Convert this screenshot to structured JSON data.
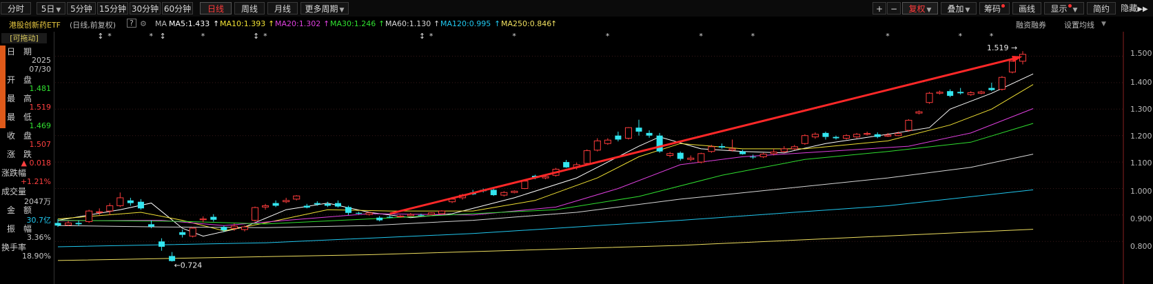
{
  "toolbar": {
    "left": [
      "分时",
      "5日",
      "5分钟",
      "15分钟",
      "30分钟",
      "60分钟",
      "日线",
      "周线",
      "月线",
      "更多周期"
    ],
    "active": "日线",
    "right": [
      "+",
      "−",
      "复权",
      "叠加",
      "筹码",
      "画线",
      "显示",
      "简约",
      "隐藏"
    ]
  },
  "info": {
    "name": "港股创新药ETF",
    "period": "(日线,前复权)",
    "help": "?",
    "ma_label": "MA",
    "ma": [
      {
        "text": "MA5:1.433",
        "color": "#ffffff"
      },
      {
        "text": "MA10:1.393",
        "color": "#f2e234"
      },
      {
        "text": "MA20:1.302",
        "color": "#e040e0"
      },
      {
        "text": "MA30:1.246",
        "color": "#30e030"
      },
      {
        "text": "MA60:1.130",
        "color": "#d8d8d8"
      },
      {
        "text": "MA120:0.995",
        "color": "#20c8f0"
      },
      {
        "text": "MA250:0.846",
        "color": "#f0e060"
      }
    ],
    "right1": "融资融券",
    "right2": "设置均线"
  },
  "panel": {
    "drag": "[可拖动]",
    "rows": [
      {
        "label": "日　期",
        "value": "2025",
        "value2": "07/30",
        "color": "#c8c8c8"
      },
      {
        "label": "开　盘",
        "value": "1.481",
        "color": "#30e030"
      },
      {
        "label": "最　高",
        "value": "1.519",
        "color": "#ff4040"
      },
      {
        "label": "最　低",
        "value": "1.469",
        "color": "#30e030"
      },
      {
        "label": "收　盘",
        "value": "1.507",
        "color": "#ff4040"
      },
      {
        "label": "涨　跌",
        "value": "▲ 0.018",
        "color": "#ff4040"
      },
      {
        "label": "涨跌幅",
        "value": "+1.21%",
        "color": "#ff4040"
      },
      {
        "label": "成交量",
        "value": "2047万",
        "color": "#c8c8c8"
      },
      {
        "label": "金　额",
        "value": "30.7亿",
        "color": "#20c8f0"
      },
      {
        "label": "振　幅",
        "value": "3.36%",
        "color": "#c8c8c8"
      },
      {
        "label": "换手率",
        "value": "18.90%",
        "color": "#c8c8c8"
      }
    ]
  },
  "chart_data": {
    "type": "candlestick",
    "y_ticks": [
      "1.500",
      "1.400",
      "1.300",
      "1.200",
      "1.100",
      "1.000",
      "0.900",
      "0.800"
    ],
    "ylim": [
      0.72,
      1.53
    ],
    "high_marker": "1.519",
    "low_marker": "0.724",
    "candles": [
      [
        0.87,
        0.86,
        0.885,
        0.855
      ],
      [
        0.862,
        0.87,
        0.878,
        0.858
      ],
      [
        0.87,
        0.865,
        0.88,
        0.858
      ],
      [
        0.875,
        0.915,
        0.92,
        0.87
      ],
      [
        0.91,
        0.912,
        0.925,
        0.9
      ],
      [
        0.915,
        0.935,
        0.945,
        0.9
      ],
      [
        0.935,
        0.965,
        0.985,
        0.93
      ],
      [
        0.955,
        0.945,
        0.965,
        0.935
      ],
      [
        0.95,
        0.925,
        0.96,
        0.92
      ],
      [
        0.865,
        0.856,
        0.88,
        0.85
      ],
      [
        0.8,
        0.78,
        0.812,
        0.765
      ],
      [
        0.745,
        0.726,
        0.76,
        0.724
      ],
      [
        0.835,
        0.825,
        0.845,
        0.815
      ],
      [
        0.82,
        0.85,
        0.855,
        0.815
      ],
      [
        0.882,
        0.885,
        0.895,
        0.872
      ],
      [
        0.893,
        0.882,
        0.903,
        0.875
      ],
      [
        0.855,
        0.842,
        0.86,
        0.835
      ],
      [
        0.85,
        0.858,
        0.868,
        0.84
      ],
      [
        0.845,
        0.855,
        0.86,
        0.838
      ],
      [
        0.88,
        0.928,
        0.932,
        0.875
      ],
      [
        0.93,
        0.935,
        0.942,
        0.92
      ],
      [
        0.945,
        0.935,
        0.955,
        0.93
      ],
      [
        0.95,
        0.955,
        0.965,
        0.945
      ],
      [
        0.96,
        0.972,
        0.975,
        0.955
      ],
      [
        0.935,
        0.928,
        0.942,
        0.925
      ],
      [
        0.945,
        0.94,
        0.952,
        0.935
      ],
      [
        0.942,
        0.935,
        0.95,
        0.93
      ],
      [
        0.945,
        0.932,
        0.955,
        0.928
      ],
      [
        0.93,
        0.908,
        0.935,
        0.9
      ],
      [
        0.908,
        0.905,
        0.912,
        0.902
      ],
      [
        0.902,
        0.908,
        0.912,
        0.898
      ],
      [
        0.89,
        0.88,
        0.896,
        0.876
      ],
      [
        0.893,
        0.89,
        0.898,
        0.888
      ],
      [
        0.893,
        0.896,
        0.9,
        0.89
      ],
      [
        0.897,
        0.902,
        0.908,
        0.895
      ],
      [
        0.9,
        0.898,
        0.905,
        0.896
      ],
      [
        0.902,
        0.908,
        0.91,
        0.9
      ],
      [
        0.905,
        0.915,
        0.918,
        0.903
      ],
      [
        0.95,
        0.96,
        0.968,
        0.945
      ],
      [
        0.965,
        0.975,
        0.98,
        0.958
      ],
      [
        0.985,
        0.978,
        0.995,
        0.975
      ],
      [
        0.995,
        0.99,
        1.0,
        0.985
      ],
      [
        0.995,
        0.975,
        1.0,
        0.972
      ],
      [
        0.975,
        0.985,
        0.99,
        0.97
      ],
      [
        0.985,
        0.99,
        0.993,
        0.982
      ],
      [
        1.0,
        1.028,
        1.03,
        0.998
      ],
      [
        1.048,
        1.04,
        1.052,
        1.035
      ],
      [
        1.04,
        1.045,
        1.05,
        1.035
      ],
      [
        1.05,
        1.073,
        1.078,
        1.045
      ],
      [
        1.1,
        1.08,
        1.108,
        1.078
      ],
      [
        1.08,
        1.09,
        1.098,
        1.072
      ],
      [
        1.095,
        1.143,
        1.148,
        1.09
      ],
      [
        1.145,
        1.18,
        1.19,
        1.14
      ],
      [
        1.17,
        1.183,
        1.19,
        1.165
      ],
      [
        1.2,
        1.185,
        1.215,
        1.178
      ],
      [
        1.19,
        1.23,
        1.232,
        1.185
      ],
      [
        1.23,
        1.215,
        1.26,
        1.2
      ],
      [
        1.21,
        1.2,
        1.22,
        1.192
      ],
      [
        1.2,
        1.14,
        1.21,
        1.135
      ],
      [
        1.125,
        1.132,
        1.138,
        1.118
      ],
      [
        1.135,
        1.112,
        1.14,
        1.105
      ],
      [
        1.11,
        1.115,
        1.125,
        1.103
      ],
      [
        1.1,
        1.132,
        1.135,
        1.095
      ],
      [
        1.14,
        1.158,
        1.165,
        1.135
      ],
      [
        1.16,
        1.155,
        1.17,
        1.15
      ],
      [
        1.145,
        1.15,
        1.185,
        1.14
      ],
      [
        1.14,
        1.13,
        1.146,
        1.128
      ],
      [
        1.12,
        1.118,
        1.128,
        1.112
      ],
      [
        1.12,
        1.13,
        1.135,
        1.115
      ],
      [
        1.132,
        1.138,
        1.15,
        1.125
      ],
      [
        1.14,
        1.15,
        1.16,
        1.135
      ],
      [
        1.15,
        1.158,
        1.165,
        1.145
      ],
      [
        1.17,
        1.2,
        1.205,
        1.165
      ],
      [
        1.195,
        1.205,
        1.212,
        1.188
      ],
      [
        1.21,
        1.195,
        1.215,
        1.185
      ],
      [
        1.195,
        1.19,
        1.2,
        1.185
      ],
      [
        1.19,
        1.2,
        1.205,
        1.185
      ],
      [
        1.195,
        1.205,
        1.21,
        1.19
      ],
      [
        1.205,
        1.208,
        1.215,
        1.2
      ],
      [
        1.205,
        1.195,
        1.212,
        1.19
      ],
      [
        1.198,
        1.202,
        1.21,
        1.195
      ],
      [
        1.2,
        1.208,
        1.215,
        1.198
      ],
      [
        1.22,
        1.258,
        1.262,
        1.215
      ],
      [
        1.285,
        1.29,
        1.295,
        1.28
      ],
      [
        1.325,
        1.36,
        1.365,
        1.32
      ],
      [
        1.36,
        1.364,
        1.37,
        1.355
      ],
      [
        1.368,
        1.35,
        1.375,
        1.345
      ],
      [
        1.365,
        1.36,
        1.38,
        1.355
      ],
      [
        1.355,
        1.362,
        1.368,
        1.35
      ],
      [
        1.36,
        1.365,
        1.37,
        1.356
      ],
      [
        1.38,
        1.372,
        1.4,
        1.368
      ],
      [
        1.375,
        1.42,
        1.425,
        1.37
      ],
      [
        1.44,
        1.481,
        1.485,
        1.435
      ],
      [
        1.481,
        1.507,
        1.519,
        1.469
      ]
    ],
    "ma": {
      "MA5": {
        "color": "#ffffff",
        "points": [
          [
            0,
            0.88
          ],
          [
            6,
            0.92
          ],
          [
            9,
            0.945
          ],
          [
            12,
            0.85
          ],
          [
            14,
            0.82
          ],
          [
            18,
            0.855
          ],
          [
            22,
            0.92
          ],
          [
            26,
            0.945
          ],
          [
            30,
            0.91
          ],
          [
            34,
            0.89
          ],
          [
            38,
            0.905
          ],
          [
            44,
            0.965
          ],
          [
            50,
            1.04
          ],
          [
            56,
            1.16
          ],
          [
            58,
            1.195
          ],
          [
            62,
            1.15
          ],
          [
            66,
            1.14
          ],
          [
            70,
            1.135
          ],
          [
            74,
            1.17
          ],
          [
            80,
            1.205
          ],
          [
            84,
            1.23
          ],
          [
            86,
            1.3
          ],
          [
            90,
            1.36
          ],
          [
            94,
            1.433
          ]
        ]
      },
      "MA10": {
        "color": "#f2e234",
        "points": [
          [
            0,
            0.885
          ],
          [
            8,
            0.91
          ],
          [
            12,
            0.88
          ],
          [
            16,
            0.84
          ],
          [
            20,
            0.87
          ],
          [
            26,
            0.92
          ],
          [
            32,
            0.915
          ],
          [
            40,
            0.915
          ],
          [
            46,
            0.955
          ],
          [
            52,
            1.04
          ],
          [
            56,
            1.12
          ],
          [
            60,
            1.17
          ],
          [
            66,
            1.15
          ],
          [
            72,
            1.15
          ],
          [
            80,
            1.18
          ],
          [
            86,
            1.24
          ],
          [
            90,
            1.3
          ],
          [
            94,
            1.393
          ]
        ]
      },
      "MA20": {
        "color": "#e040e0",
        "points": [
          [
            0,
            0.878
          ],
          [
            10,
            0.88
          ],
          [
            16,
            0.86
          ],
          [
            22,
            0.88
          ],
          [
            30,
            0.905
          ],
          [
            40,
            0.9
          ],
          [
            48,
            0.93
          ],
          [
            54,
            1.0
          ],
          [
            60,
            1.09
          ],
          [
            66,
            1.12
          ],
          [
            74,
            1.14
          ],
          [
            82,
            1.16
          ],
          [
            88,
            1.21
          ],
          [
            94,
            1.302
          ]
        ]
      },
      "MA30": {
        "color": "#30e030",
        "points": [
          [
            0,
            0.88
          ],
          [
            12,
            0.876
          ],
          [
            20,
            0.866
          ],
          [
            30,
            0.885
          ],
          [
            40,
            0.905
          ],
          [
            48,
            0.92
          ],
          [
            56,
            0.97
          ],
          [
            64,
            1.05
          ],
          [
            72,
            1.11
          ],
          [
            80,
            1.14
          ],
          [
            88,
            1.175
          ],
          [
            94,
            1.246
          ]
        ]
      },
      "MA60": {
        "color": "#d8d8d8",
        "points": [
          [
            0,
            0.86
          ],
          [
            10,
            0.855
          ],
          [
            20,
            0.852
          ],
          [
            30,
            0.86
          ],
          [
            40,
            0.88
          ],
          [
            50,
            0.91
          ],
          [
            60,
            0.96
          ],
          [
            70,
            1.0
          ],
          [
            80,
            1.04
          ],
          [
            88,
            1.08
          ],
          [
            94,
            1.13
          ]
        ]
      },
      "MA120": {
        "color": "#20c8f0",
        "points": [
          [
            0,
            0.78
          ],
          [
            20,
            0.795
          ],
          [
            40,
            0.83
          ],
          [
            60,
            0.88
          ],
          [
            80,
            0.935
          ],
          [
            94,
            0.995
          ]
        ]
      },
      "MA250": {
        "color": "#f0e060",
        "points": [
          [
            0,
            0.728
          ],
          [
            30,
            0.75
          ],
          [
            60,
            0.785
          ],
          [
            94,
            0.846
          ]
        ]
      }
    },
    "trendline": [
      [
        32,
        0.905
      ],
      [
        93,
        1.507
      ]
    ],
    "trend_color": "#ff2828"
  }
}
